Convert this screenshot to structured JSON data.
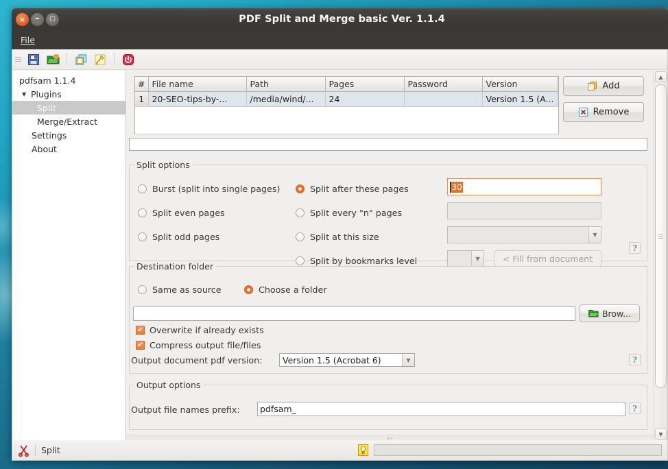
{
  "window": {
    "title": "PDF Split and Merge basic Ver. 1.1.4",
    "close_glyph": "×",
    "minimize_glyph": "–",
    "maximize_glyph": "□"
  },
  "menubar": {
    "items": [
      {
        "label": "File",
        "mnemonic": "F"
      }
    ]
  },
  "toolbar": {
    "buttons": [
      {
        "name": "save-icon",
        "tooltip": "Save"
      },
      {
        "name": "open-folder-icon",
        "tooltip": "Load"
      },
      {
        "name": "copy-windows-icon",
        "tooltip": "Duplicate"
      },
      {
        "name": "broom-icon",
        "tooltip": "Clear"
      },
      {
        "name": "power-icon",
        "tooltip": "Exit"
      }
    ]
  },
  "sidebar": {
    "items": [
      {
        "label": "pdfsam 1.1.4",
        "level": 0,
        "selected": false,
        "expander": ""
      },
      {
        "label": "Plugins",
        "level": 1,
        "selected": false,
        "expander": "▼"
      },
      {
        "label": "Split",
        "level": 2,
        "selected": true,
        "expander": ""
      },
      {
        "label": "Merge/Extract",
        "level": 2,
        "selected": false,
        "expander": ""
      },
      {
        "label": "Settings",
        "level": 1,
        "selected": false,
        "expander": ""
      },
      {
        "label": "About",
        "level": 1,
        "selected": false,
        "expander": ""
      }
    ]
  },
  "file_table": {
    "headers": [
      "#",
      "File name",
      "Path",
      "Pages",
      "Password",
      "Version"
    ],
    "rows": [
      {
        "num": "1",
        "file_name": "20-SEO-tips-by-...",
        "path": "/media/wind/...",
        "pages": "24",
        "password": "",
        "version": "Version 1.5 (A..."
      }
    ]
  },
  "file_buttons": {
    "add_label": "Add",
    "remove_label": "Remove"
  },
  "wide_input": {
    "value": ""
  },
  "split_options": {
    "legend": "Split options",
    "radios": [
      {
        "label": "Burst (split into single pages)",
        "selected": false
      },
      {
        "label": "Split even pages",
        "selected": false
      },
      {
        "label": "Split odd pages",
        "selected": false
      },
      {
        "label": "Split after these pages",
        "selected": true
      },
      {
        "label": "Split every \"n\" pages",
        "selected": false
      },
      {
        "label": "Split at this size",
        "selected": false
      },
      {
        "label": "Split by bookmarks level",
        "selected": false
      }
    ],
    "after_pages_value": "30",
    "every_n_value": "",
    "size_value": "",
    "bookmarks_level_value": "",
    "fill_from_document_label": "< Fill from document",
    "help_icon": "?"
  },
  "destination": {
    "legend": "Destination folder",
    "same_as_source_label": "Same as source",
    "same_as_source_selected": false,
    "choose_folder_label": "Choose a folder",
    "choose_folder_selected": true,
    "folder_path": "",
    "browse_label": "Brow...",
    "overwrite_label": "Overwrite if already exists",
    "overwrite_checked": true,
    "compress_label": "Compress output file/files",
    "compress_checked": true,
    "pdf_version_label": "Output document pdf version:",
    "pdf_version_value": "Version 1.5 (Acrobat 6)",
    "check_glyph": "✔",
    "help_icon": "?"
  },
  "output_options": {
    "legend": "Output options",
    "prefix_label": "Output file names prefix:",
    "prefix_value": "pdfsam_",
    "help_icon": "?"
  },
  "statusbar": {
    "plugin_name": "Split",
    "scissors_icon": "✂",
    "bulb_icon": "●",
    "progress_value": ""
  },
  "colors": {
    "accent_orange": "#e8712b",
    "titlebar": "#3c3a36",
    "panel_bg": "#f0efed",
    "selection_gray": "#c9c9c9",
    "desktop_teal": "#1d7e9c"
  }
}
